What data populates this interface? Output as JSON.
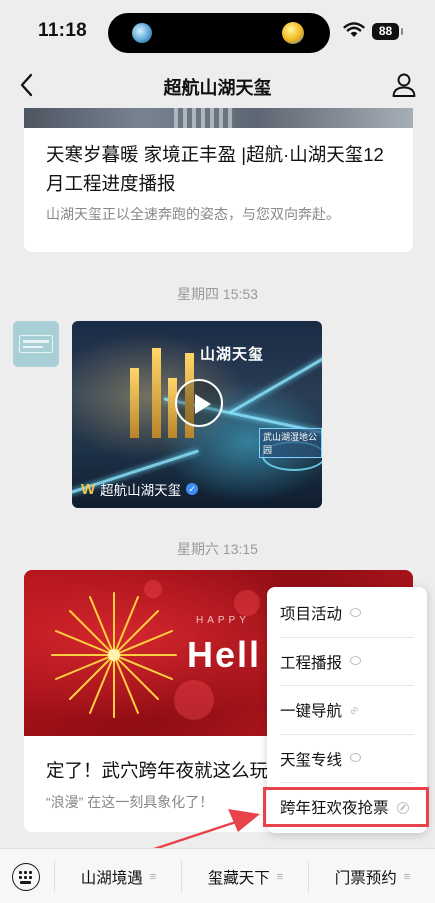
{
  "status": {
    "time": "11:18",
    "battery": "88"
  },
  "nav": {
    "title": "超航山湖天玺"
  },
  "article1": {
    "title": "天寒岁暮暖 家境正丰盈 |超航·山湖天玺12月工程进度播报",
    "desc": "山湖天玺正以全速奔跑的姿态，与您双向奔赴。"
  },
  "timestamps": [
    "星期四 15:53",
    "星期六 13:15"
  ],
  "video": {
    "account": "超航山湖天玺",
    "sign_text": "山湖天玺",
    "map_label": "武山湖湿地公园"
  },
  "article2": {
    "banner_top": "HAPPY",
    "banner_text": "Hell",
    "title": "定了！武穴跨年夜就这么玩",
    "desc": "“浪漫” 在这一刻具象化了！"
  },
  "menu": {
    "items": [
      {
        "label": "项目活动",
        "icon": "message-icon"
      },
      {
        "label": "工程播报",
        "icon": "message-icon"
      },
      {
        "label": "一键导航",
        "icon": "link-icon"
      },
      {
        "label": "天玺专线",
        "icon": "message-icon"
      },
      {
        "label": "跨年狂欢夜抢票",
        "icon": "miniprogram-icon"
      }
    ],
    "highlight_color": "#e8434a"
  },
  "bottom_tabs": [
    {
      "label": "山湖境遇"
    },
    {
      "label": "玺藏天下"
    },
    {
      "label": "门票预约"
    }
  ]
}
